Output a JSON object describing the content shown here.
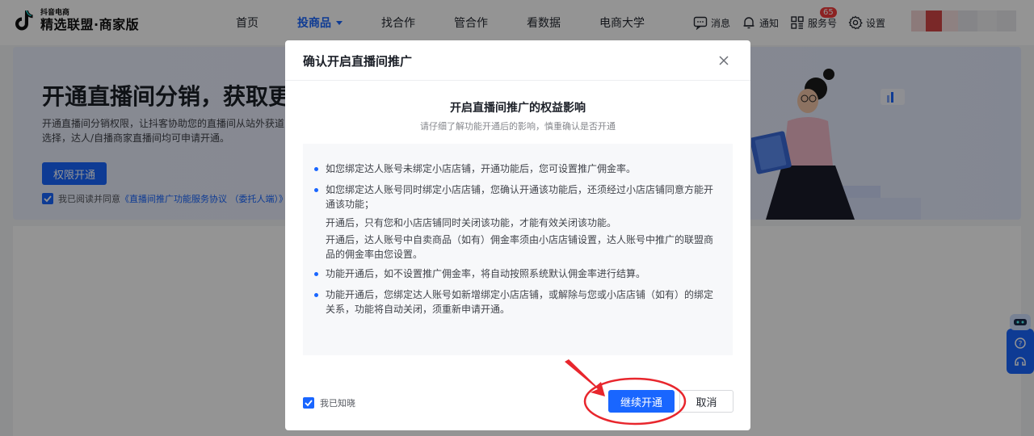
{
  "header": {
    "logo_small": "抖音电商",
    "logo_big": "精选联盟·商家版",
    "nav": [
      {
        "label": "首页"
      },
      {
        "label": "投商品"
      },
      {
        "label": "找合作"
      },
      {
        "label": "管合作"
      },
      {
        "label": "看数据"
      },
      {
        "label": "电商大学"
      }
    ],
    "right": {
      "messages_label": "消息",
      "notifications_label": "通知",
      "notifications_badge": "65",
      "service_label": "服务号",
      "settings_label": "设置"
    }
  },
  "background": {
    "title": "开通直播间分销，获取更",
    "desc": "开通直播间分销权限，让抖客协助您的直播间从站外获道选择，达人/自播商家直播间均可申请开通。",
    "button_label": "权限开通",
    "agree_prefix": "我已阅读并同意",
    "agree_link": "《直播间推广功能服务协议 （委托人端）》"
  },
  "modal": {
    "title": "确认开启直播间推广",
    "section_title": "开启直播间推广的权益影响",
    "section_subtitle": "请仔细了解功能开通后的影响，慎重确认是否开通",
    "items": [
      {
        "text": "如您绑定达人账号未绑定小店店铺，开通功能后，您可设置推广佣金率。",
        "bullet": true
      },
      {
        "text": "如您绑定达人账号同时绑定小店店铺，您确认开通该功能后，还须经过小店店铺同意方能开通该功能；",
        "bullet": true
      },
      {
        "text": "开通后，只有您和小店店铺同时关闭该功能，才能有效关闭该功能。",
        "bullet": false
      },
      {
        "text": "开通后，达人账号中自卖商品（如有）佣金率须由小店店铺设置，达人账号中推广的联盟商品的佣金率由您设置。",
        "bullet": false
      },
      {
        "text": "功能开通后，如不设置推广佣金率，将自动按照系统默认佣金率进行结算。",
        "bullet": true
      },
      {
        "text": "功能开通后，您绑定达人账号如新增绑定小店店铺，或解除与您或小店店铺（如有）的绑定关系，功能将自动关闭，须重新申请开通。",
        "bullet": true
      }
    ],
    "ack_label": "我已知晓",
    "confirm_label": "继续开通",
    "cancel_label": "取消"
  },
  "colors": {
    "accent": "#1966ff",
    "annotation": "#e8262d",
    "badge": "#f23c3c"
  }
}
